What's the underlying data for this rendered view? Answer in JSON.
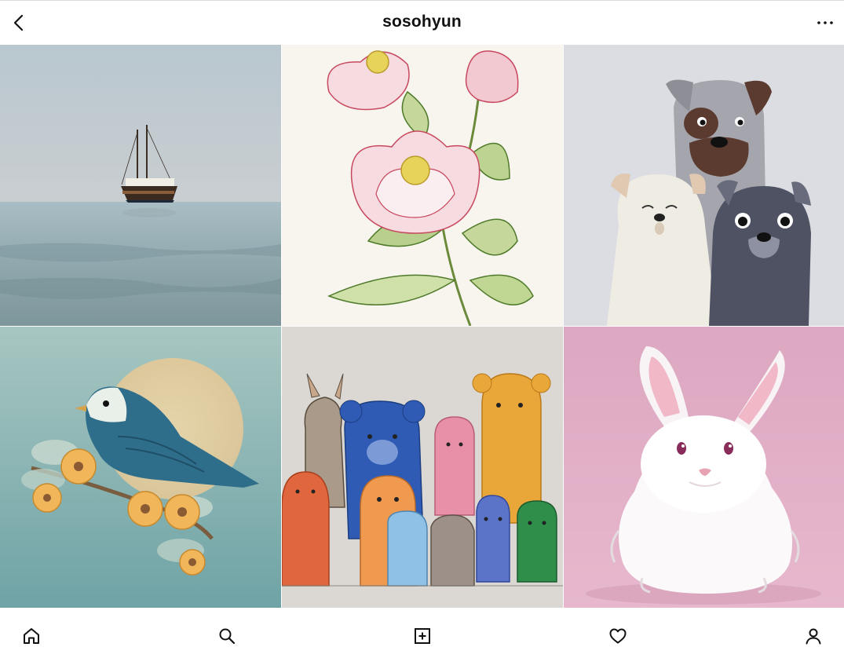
{
  "header": {
    "username": "sosohyun"
  },
  "icons": {
    "back": "chevron-left-icon",
    "more": "more-horizontal-icon",
    "home": "home-icon",
    "search": "search-icon",
    "new_post": "plus-square-icon",
    "activity": "heart-icon",
    "profile": "user-icon"
  },
  "posts": [
    {
      "subject": "sailboat-on-sea"
    },
    {
      "subject": "peony-flower-illustration"
    },
    {
      "subject": "three-dogs-illustration"
    },
    {
      "subject": "blue-bird-on-branch"
    },
    {
      "subject": "crayon-animals-drawing"
    },
    {
      "subject": "white-fluffy-bunny"
    }
  ],
  "colors": {
    "text": "#111111",
    "divider": "#dbdbdb",
    "background": "#ffffff"
  }
}
